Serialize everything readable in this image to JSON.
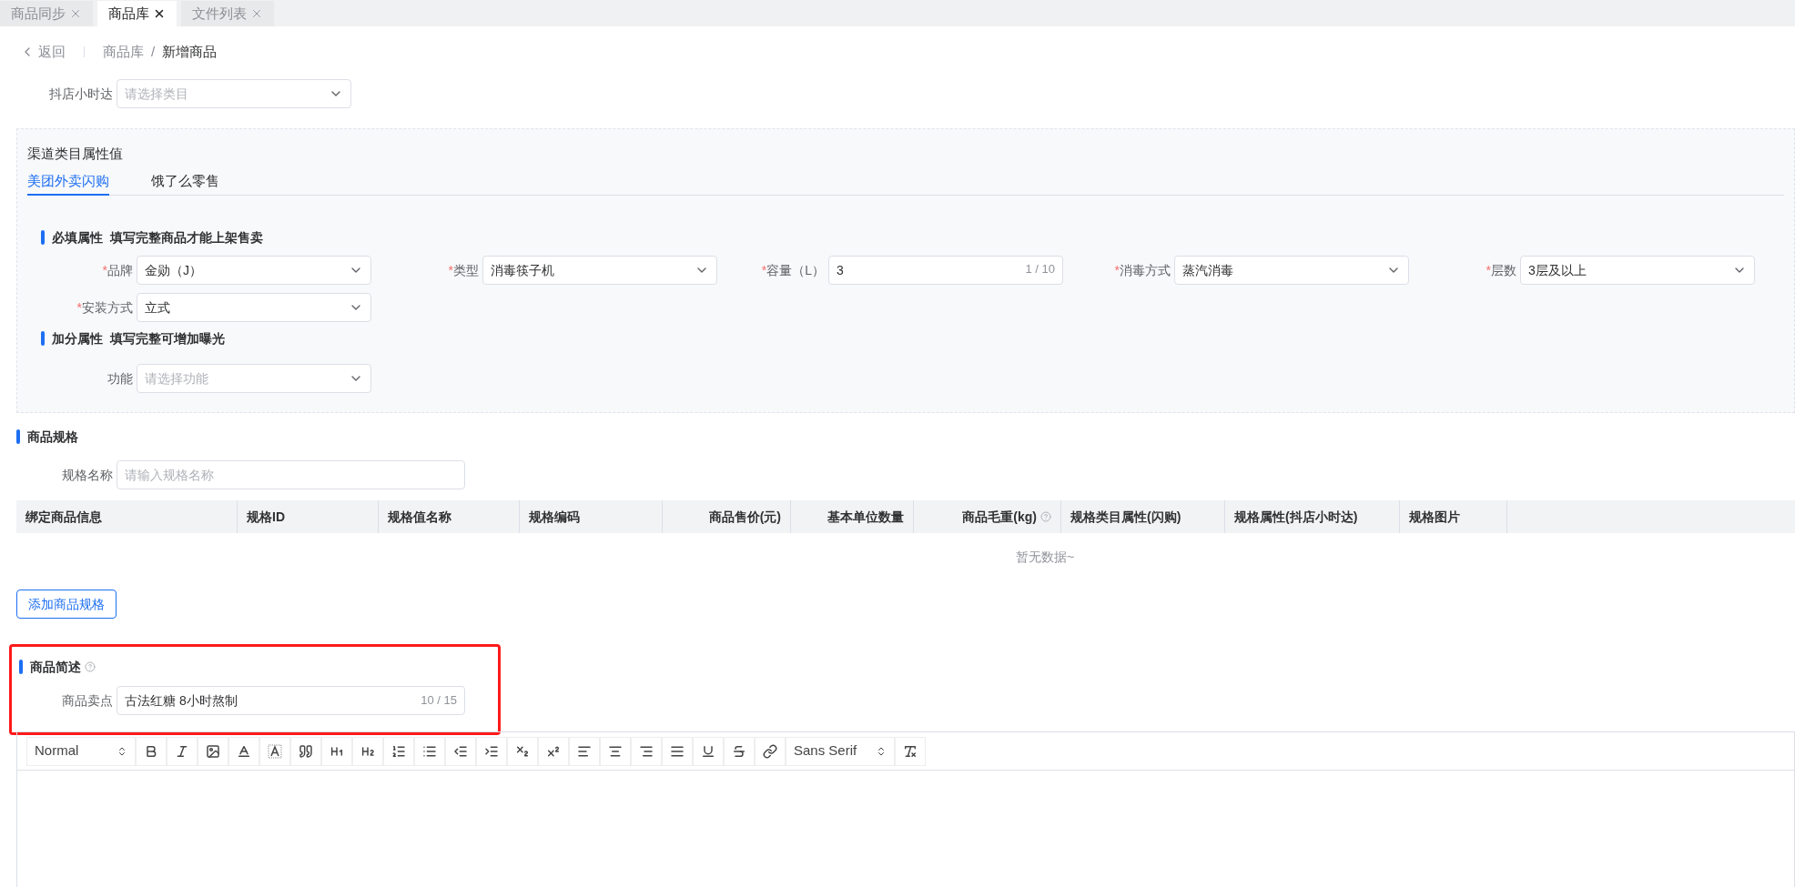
{
  "tabs": [
    {
      "label": "商品同步",
      "selected": false
    },
    {
      "label": "商品库",
      "selected": true
    },
    {
      "label": "文件列表",
      "selected": false
    }
  ],
  "breadcrumb": {
    "back": "返回",
    "items": [
      "商品库",
      "/",
      "新增商品"
    ]
  },
  "douyin_field": {
    "label": "抖店小时达",
    "placeholder": "请选择类目"
  },
  "required_mark": "*",
  "channel_panel": {
    "title": "渠道类目属性值",
    "tabs": [
      {
        "label": "美团外卖闪购",
        "selected": true
      },
      {
        "label": "饿了么零售",
        "selected": false
      }
    ],
    "groups": [
      {
        "title": "必填属性",
        "hint": "填写完整商品才能上架售卖",
        "fields": [
          {
            "kind": "select",
            "label": "品牌",
            "required": true,
            "value": "金勋（J）"
          },
          {
            "kind": "select",
            "label": "类型",
            "required": true,
            "value": "消毒筷子机"
          },
          {
            "kind": "input",
            "label": "容量（L）",
            "required": true,
            "value": "3",
            "counter": "1 / 10"
          },
          {
            "kind": "select",
            "label": "消毒方式",
            "required": true,
            "value": "蒸汽消毒"
          },
          {
            "kind": "select",
            "label": "层数",
            "required": true,
            "value": "3层及以上"
          },
          {
            "kind": "select",
            "label": "安装方式",
            "required": true,
            "value": "立式"
          }
        ]
      },
      {
        "title": "加分属性",
        "hint": "填写完整可增加曝光",
        "fields": [
          {
            "kind": "select",
            "label": "功能",
            "required": false,
            "placeholder": "请选择功能"
          }
        ]
      }
    ]
  },
  "spec_section": {
    "title": "商品规格",
    "name_field": {
      "label": "规格名称",
      "placeholder": "请输入规格名称"
    },
    "table": {
      "columns": [
        {
          "label": "绑定商品信息",
          "help": false
        },
        {
          "label": "规格ID",
          "help": false
        },
        {
          "label": "规格值名称",
          "help": false
        },
        {
          "label": "规格编码",
          "help": false
        },
        {
          "label": "商品售价(元)",
          "help": false
        },
        {
          "label": "基本单位数量",
          "help": false
        },
        {
          "label": "商品毛重(kg)",
          "help": true
        },
        {
          "label": "规格类目属性(闪购)",
          "help": false
        },
        {
          "label": "规格属性(抖店小时达)",
          "help": false
        },
        {
          "label": "规格图片",
          "help": false
        }
      ],
      "empty_text": "暂无数据~"
    },
    "add_button": "添加商品规格"
  },
  "summary_section": {
    "title": "商品简述",
    "highlighted": true,
    "field": {
      "label": "商品卖点",
      "value": "古法红糖 8小时熬制",
      "counter": "10 / 15"
    }
  },
  "editor": {
    "toolbar": [
      {
        "kind": "picker",
        "label": "Normal"
      },
      {
        "kind": "bold"
      },
      {
        "kind": "italic"
      },
      {
        "kind": "image"
      },
      {
        "kind": "color"
      },
      {
        "kind": "background"
      },
      {
        "kind": "quote"
      },
      {
        "kind": "h1"
      },
      {
        "kind": "h2"
      },
      {
        "kind": "ordered-list"
      },
      {
        "kind": "bullet-list"
      },
      {
        "kind": "outdent"
      },
      {
        "kind": "indent"
      },
      {
        "kind": "subscript"
      },
      {
        "kind": "superscript"
      },
      {
        "kind": "align-left"
      },
      {
        "kind": "align-center"
      },
      {
        "kind": "align-right"
      },
      {
        "kind": "justify"
      },
      {
        "kind": "underline"
      },
      {
        "kind": "strike"
      },
      {
        "kind": "link"
      },
      {
        "kind": "picker",
        "label": "Sans Serif"
      },
      {
        "kind": "clean"
      }
    ]
  }
}
